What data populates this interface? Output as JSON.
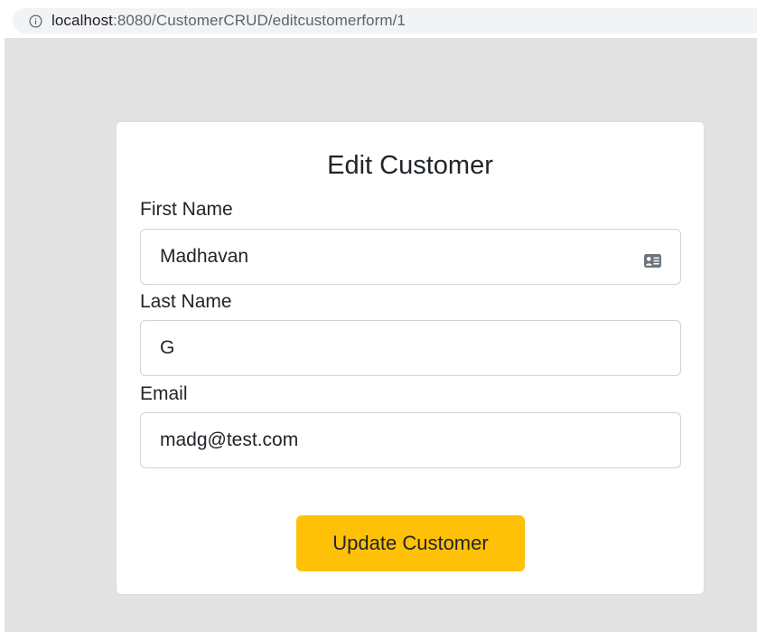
{
  "browser": {
    "url_host": "localhost",
    "url_path": ":8080/CustomerCRUD/editcustomerform/1",
    "info_icon": "info-circle-icon"
  },
  "form": {
    "title": "Edit Customer",
    "fields": [
      {
        "label": "First Name",
        "value": "Madhavan",
        "icon": "contact-card-icon"
      },
      {
        "label": "Last Name",
        "value": "G"
      },
      {
        "label": "Email",
        "value": "madg@test.com"
      }
    ],
    "submit_label": "Update Customer"
  },
  "colors": {
    "page_background": "#e2e2e2",
    "card_background": "#ffffff",
    "button_background": "#ffc107",
    "input_border": "#ced4da"
  }
}
